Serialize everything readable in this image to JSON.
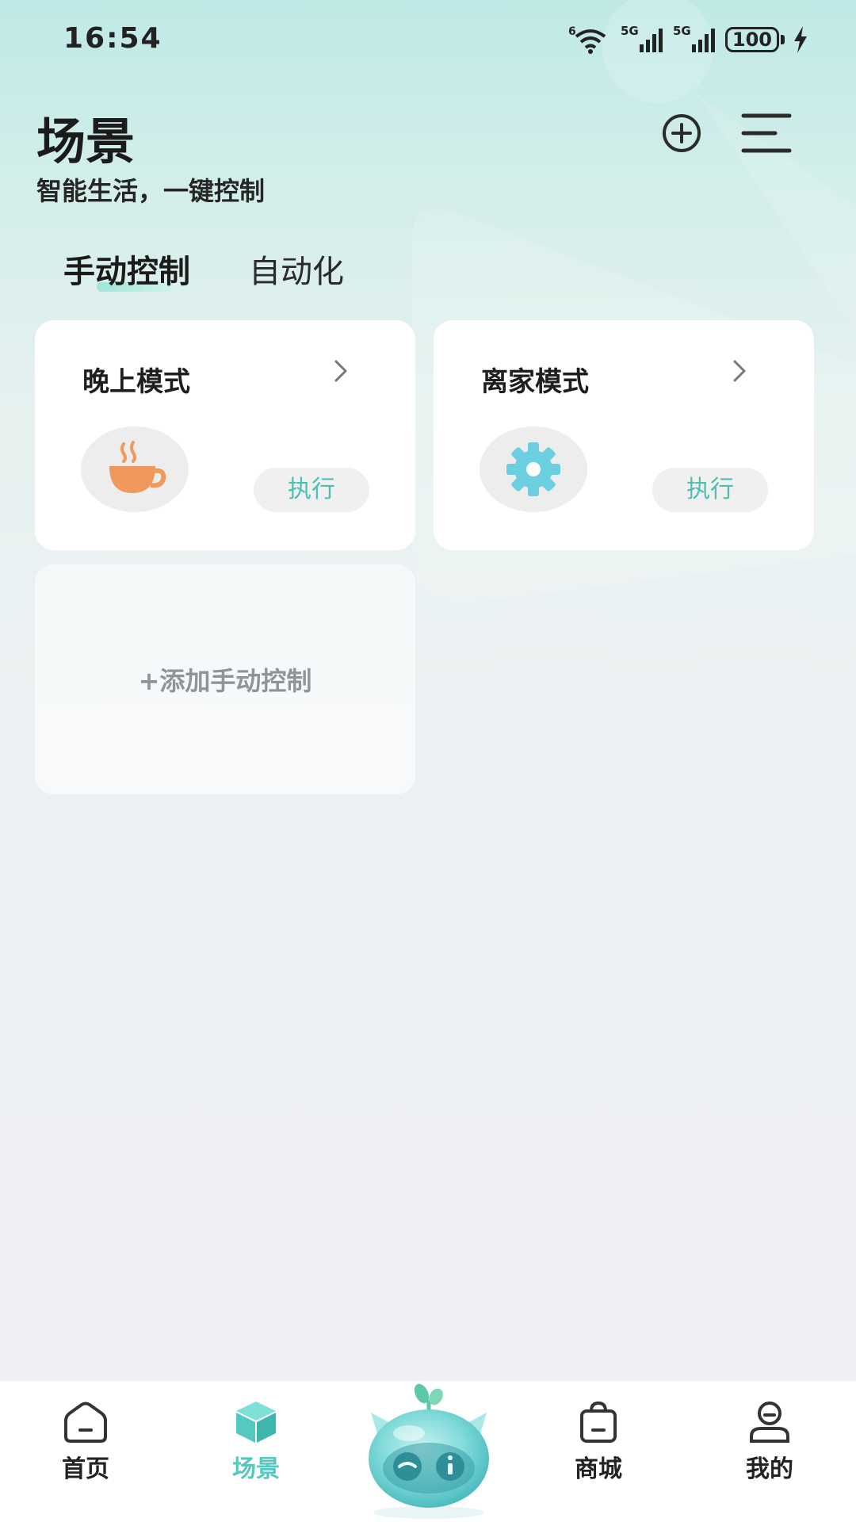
{
  "status_bar": {
    "time": "16:54",
    "battery": "100",
    "icons": [
      "wifi-icon",
      "5g-signal-icon",
      "5g-signal-icon",
      "battery-icon",
      "charging-icon"
    ],
    "signal_labels": [
      "6",
      "5G",
      "5G"
    ]
  },
  "header": {
    "title": "场景",
    "subtitle": "智能生活，一键控制",
    "add_icon": "add-circle-icon",
    "menu_icon": "menu-icon"
  },
  "tabs": [
    {
      "label": "手动控制",
      "active": true
    },
    {
      "label": "自动化",
      "active": false
    }
  ],
  "scenes": [
    {
      "title": "晚上模式",
      "icon": "coffee-cup-icon",
      "action": "执行"
    },
    {
      "title": "离家模式",
      "icon": "gear-icon",
      "action": "执行"
    }
  ],
  "add_card": {
    "label": "+添加手动控制"
  },
  "bottom_nav": [
    {
      "label": "首页",
      "icon": "home-icon",
      "active": false
    },
    {
      "label": "场景",
      "icon": "cube-icon",
      "active": true
    },
    {
      "label": "商城",
      "icon": "shopping-bag-icon",
      "active": false
    },
    {
      "label": "我的",
      "icon": "profile-icon",
      "active": false
    }
  ],
  "colors": {
    "accent": "#55c8c0",
    "execute_text": "#4dbfb0",
    "cup": "#ef9a5c",
    "gear": "#6ccfe0"
  }
}
